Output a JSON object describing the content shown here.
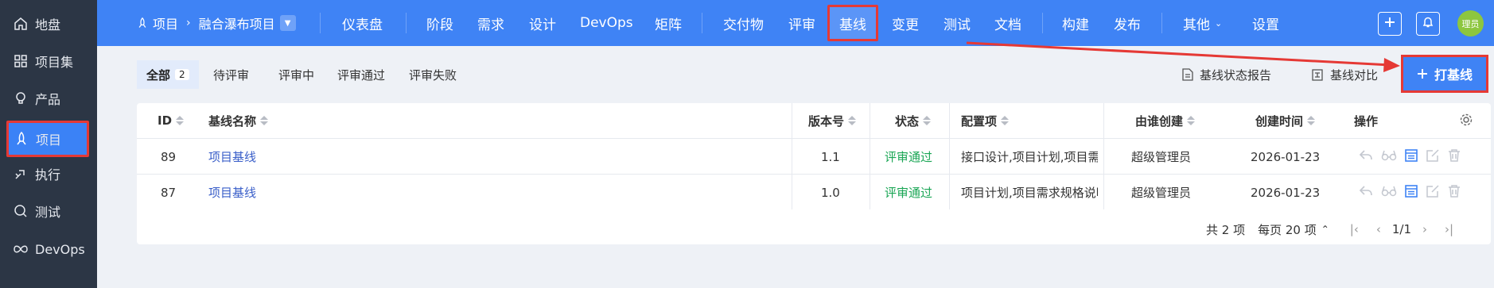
{
  "sidebar": {
    "items": [
      {
        "label": "地盘",
        "icon": "home-icon"
      },
      {
        "label": "项目集",
        "icon": "grid-icon"
      },
      {
        "label": "产品",
        "icon": "lightbulb-icon"
      },
      {
        "label": "项目",
        "icon": "rocket-icon",
        "active": true
      },
      {
        "label": "执行",
        "icon": "run-icon"
      },
      {
        "label": "测试",
        "icon": "test-icon"
      },
      {
        "label": "DevOps",
        "icon": "infinity-icon"
      }
    ]
  },
  "header": {
    "breadcrumb_root": "项目",
    "breadcrumb_project": "融合瀑布项目",
    "nav": [
      "仪表盘",
      "阶段",
      "需求",
      "设计",
      "DevOps",
      "矩阵",
      "交付物",
      "评审",
      "基线",
      "变更",
      "测试",
      "文档",
      "构建",
      "发布",
      "其他",
      "设置"
    ],
    "active_nav": "基线",
    "avatar_text": "理员"
  },
  "tabs": {
    "all": "全部",
    "all_count": "2",
    "pending": "待评审",
    "reviewing": "评审中",
    "passed": "评审通过",
    "failed": "评审失败"
  },
  "tools": {
    "report": "基线状态报告",
    "compare": "基线对比",
    "add": "打基线"
  },
  "table": {
    "headers": {
      "id": "ID",
      "name": "基线名称",
      "version": "版本号",
      "status": "状态",
      "config": "配置项",
      "creator": "由谁创建",
      "created": "创建时间",
      "actions": "操作"
    },
    "rows": [
      {
        "id": "89",
        "name": "项目基线",
        "version": "1.1",
        "status": "评审通过",
        "config": "接口设计,项目计划,项目需求规格说明书",
        "creator": "超级管理员",
        "created": "2026-01-23"
      },
      {
        "id": "87",
        "name": "项目基线",
        "version": "1.0",
        "status": "评审通过",
        "config": "项目计划,项目需求规格说明书",
        "creator": "超级管理员",
        "created": "2026-01-23"
      }
    ]
  },
  "pager": {
    "total": "共 2 项",
    "per_page": "每页 20 项",
    "page": "1/1"
  },
  "colors": {
    "accent": "#3f83f5",
    "sidebar": "#2c3645",
    "highlight": "#e53935",
    "success": "#1aa655"
  }
}
